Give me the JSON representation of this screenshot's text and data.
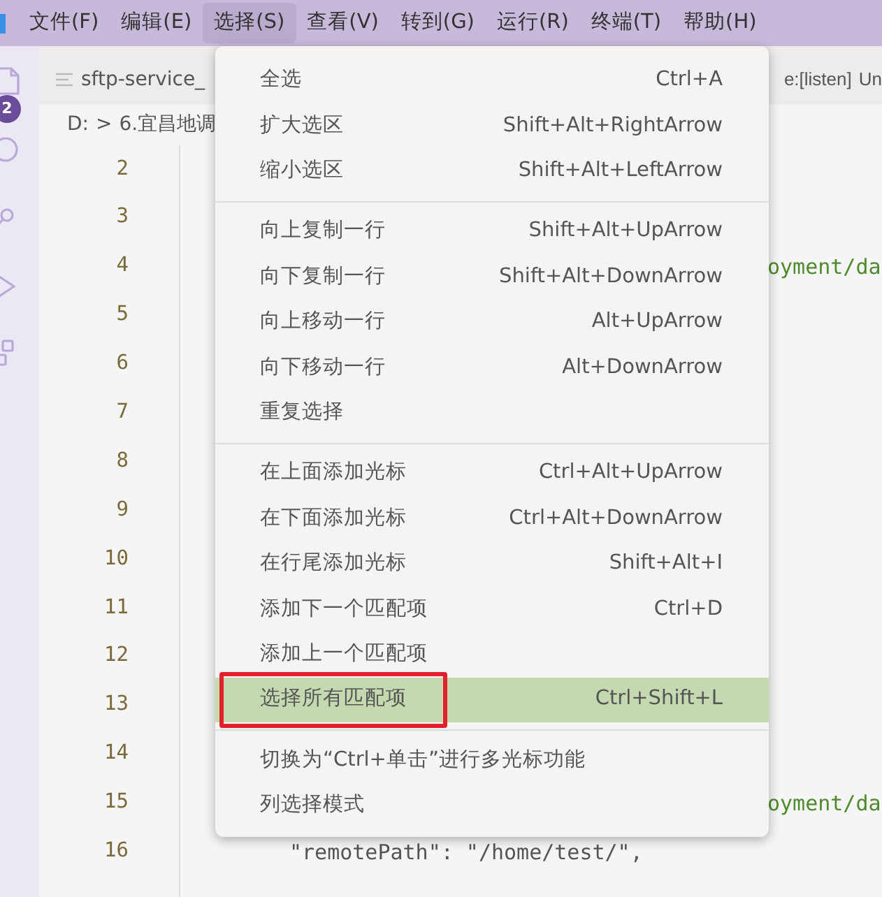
{
  "menubar": [
    {
      "label": "文件(F)",
      "selected": false
    },
    {
      "label": "编辑(E)",
      "selected": false
    },
    {
      "label": "选择(S)",
      "selected": true
    },
    {
      "label": "查看(V)",
      "selected": false
    },
    {
      "label": "转到(G)",
      "selected": false
    },
    {
      "label": "运行(R)",
      "selected": false
    },
    {
      "label": "终端(T)",
      "selected": false
    },
    {
      "label": "帮助(H)",
      "selected": false
    }
  ],
  "activity_bar": {
    "explorer_badge": "2"
  },
  "tab": {
    "title": "sftp-service_",
    "right_text": "e:[listen]",
    "right_cut": "Un"
  },
  "breadcrumb": {
    "drive": "D:",
    "separator": ">",
    "folder": "6.宜昌地调"
  },
  "editor": {
    "lines": [
      {
        "number": "2"
      },
      {
        "number": "3"
      },
      {
        "number": "4",
        "code": "oyment/da"
      },
      {
        "number": "5"
      },
      {
        "number": "6"
      },
      {
        "number": "7"
      },
      {
        "number": "8"
      },
      {
        "number": "9"
      },
      {
        "number": "10"
      },
      {
        "number": "11"
      },
      {
        "number": "12"
      },
      {
        "number": "13"
      },
      {
        "number": "14"
      },
      {
        "number": "15",
        "code": "oyment/da"
      },
      {
        "number": "16",
        "code": "\"remotePath\": \"/home/test/\","
      }
    ]
  },
  "menu": {
    "groups": [
      [
        {
          "label": "全选",
          "shortcut": "Ctrl+A",
          "selected": false,
          "outlined": false
        },
        {
          "label": "扩大选区",
          "shortcut": "Shift+Alt+RightArrow",
          "selected": false,
          "outlined": false
        },
        {
          "label": "缩小选区",
          "shortcut": "Shift+Alt+LeftArrow",
          "selected": false,
          "outlined": false
        }
      ],
      [
        {
          "label": "向上复制一行",
          "shortcut": "Shift+Alt+UpArrow",
          "selected": false,
          "outlined": false
        },
        {
          "label": "向下复制一行",
          "shortcut": "Shift+Alt+DownArrow",
          "selected": false,
          "outlined": false
        },
        {
          "label": "向上移动一行",
          "shortcut": "Alt+UpArrow",
          "selected": false,
          "outlined": false
        },
        {
          "label": "向下移动一行",
          "shortcut": "Alt+DownArrow",
          "selected": false,
          "outlined": false
        },
        {
          "label": "重复选择",
          "selected": false,
          "outlined": false
        }
      ],
      [
        {
          "label": "在上面添加光标",
          "shortcut": "Ctrl+Alt+UpArrow",
          "selected": false,
          "outlined": false
        },
        {
          "label": "在下面添加光标",
          "shortcut": "Ctrl+Alt+DownArrow",
          "selected": false,
          "outlined": false
        },
        {
          "label": "在行尾添加光标",
          "shortcut": "Shift+Alt+I",
          "selected": false,
          "outlined": false
        },
        {
          "label": "添加下一个匹配项",
          "shortcut": "Ctrl+D",
          "selected": false,
          "outlined": false
        },
        {
          "label": "添加上一个匹配项",
          "selected": false,
          "outlined": false
        },
        {
          "label": "选择所有匹配项",
          "shortcut": "Ctrl+Shift+L",
          "selected": true,
          "outlined": true
        }
      ],
      [
        {
          "label": "切换为“Ctrl+单击”进行多光标功能",
          "selected": false,
          "outlined": false
        },
        {
          "label": "列选择模式",
          "selected": false,
          "outlined": false
        }
      ]
    ]
  }
}
